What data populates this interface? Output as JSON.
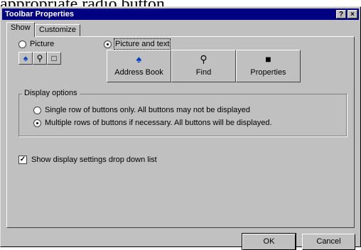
{
  "caption_text": "appropriate radio button.",
  "window": {
    "title": "Toolbar Properties",
    "help_button": "?",
    "close_button": "×"
  },
  "tabs": [
    {
      "label": "Show"
    },
    {
      "label": "Customize"
    }
  ],
  "button_style": {
    "picture_label": "Picture",
    "picture_text_label": "Picture and text",
    "picture_selected": false,
    "picture_text_selected": true
  },
  "icons": {
    "address_book": "address-book-icon",
    "find": "find-icon",
    "properties": "properties-icon"
  },
  "toolbar_buttons": [
    {
      "label": "Address Book",
      "icon": "address-book-icon"
    },
    {
      "label": "Find",
      "icon": "find-icon"
    },
    {
      "label": "Properties",
      "icon": "properties-icon"
    }
  ],
  "display_options": {
    "legend": "Display options",
    "single_row_label": "Single row of buttons only. All buttons may not be displayed",
    "multiple_rows_label": "Multiple rows of buttons if necessary. All buttons will be displayed.",
    "single_row_selected": false,
    "multiple_rows_selected": true
  },
  "show_display_settings": {
    "label": "Show display settings drop down list",
    "checked": true
  },
  "footer": {
    "ok_label": "OK",
    "cancel_label": "Cancel"
  },
  "colors": {
    "titlebar": "#000080",
    "dialog_face": "#c0c0c0"
  }
}
